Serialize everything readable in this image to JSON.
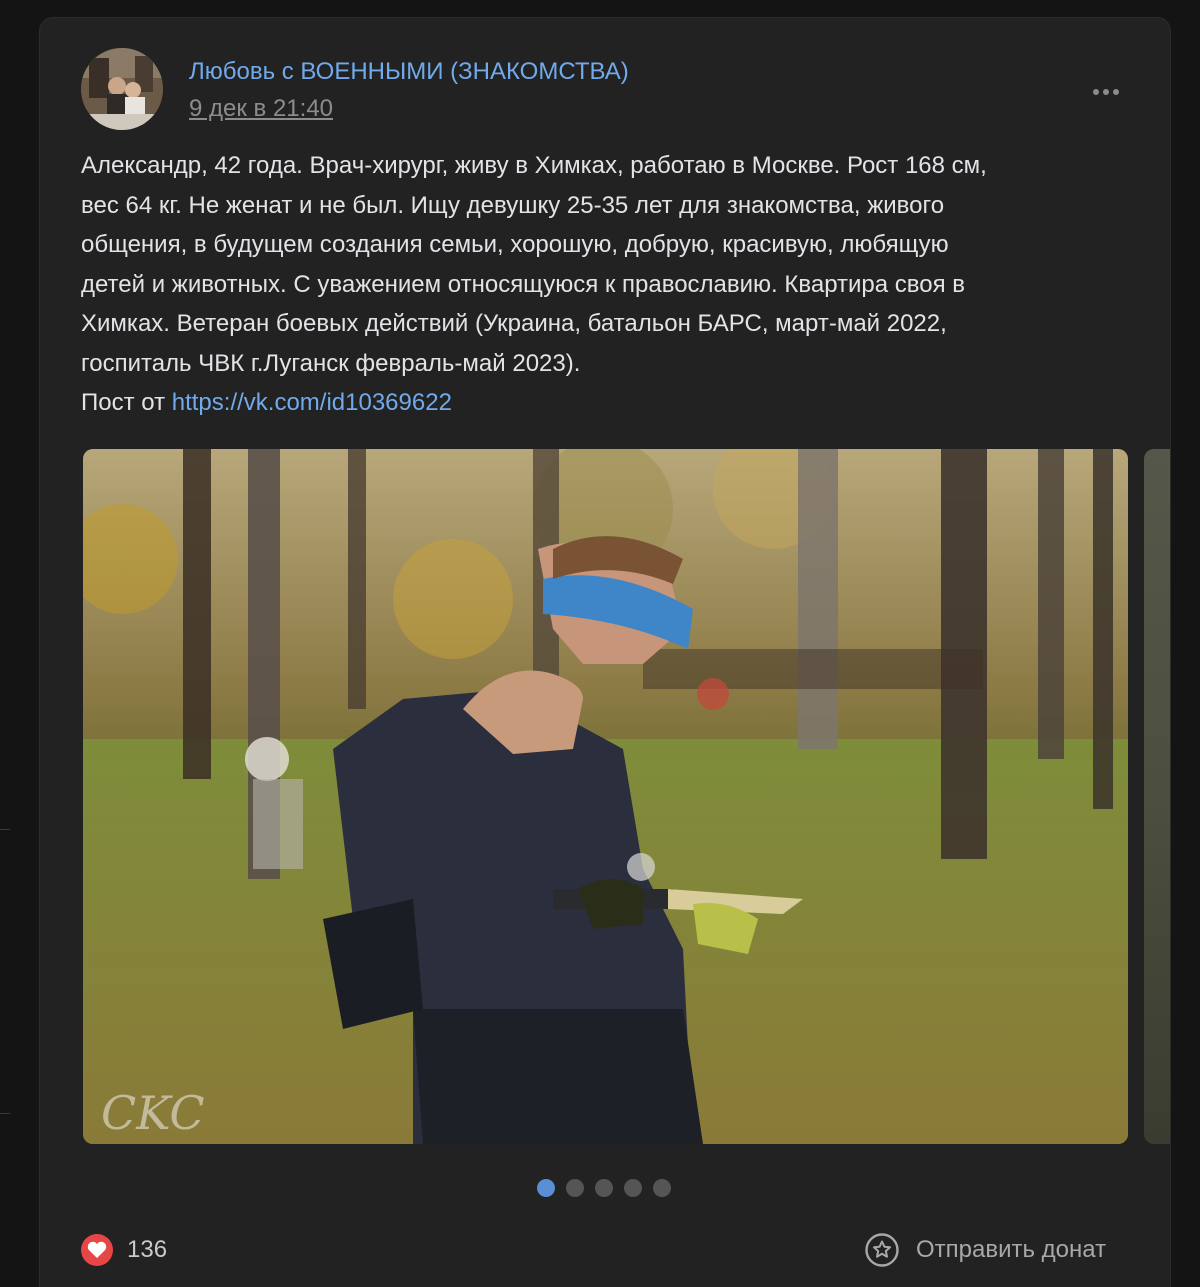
{
  "post": {
    "group_name": "Любовь с ВОЕННЫМИ (ЗНАКОМСТВА)",
    "date": "9 дек в 21:40",
    "text_lines": [
      "Александр, 42 года. Врач-хирург, живу в Химках, работаю в Москве. Рост 168 см,",
      "вес 64 кг. Не женат и не был. Ищу девушку 25-35 лет для знакомства, живого",
      "общения, в будущем создания семьи, хорошую, добрую, красивую, любящую",
      "детей и животных. С уважением относящуюся к православию. Квартира своя в",
      "Химках. Ветеран боевых действий (Украина, батальон БАРС, март-май 2022,",
      "госпиталь ЧВК г.Луганск февраль-май 2023)."
    ],
    "source_prefix": "Пост от ",
    "source_link": "https://vk.com/id10369622",
    "photo_signature": "CKC",
    "carousel_active_index": 0,
    "carousel_total": 5
  },
  "footer": {
    "like_count": "136",
    "donate_label": "Отправить донат"
  },
  "colors": {
    "background": "#141414",
    "card": "#222222",
    "accent_link": "#71aaeb",
    "text": "#e1e3e6",
    "muted": "#8c8c8c",
    "like": "#e64646",
    "active_dot": "#5a8fd6"
  },
  "icons": {
    "more": "more-dots-icon",
    "like": "heart-icon",
    "donate": "star-circle-icon"
  }
}
